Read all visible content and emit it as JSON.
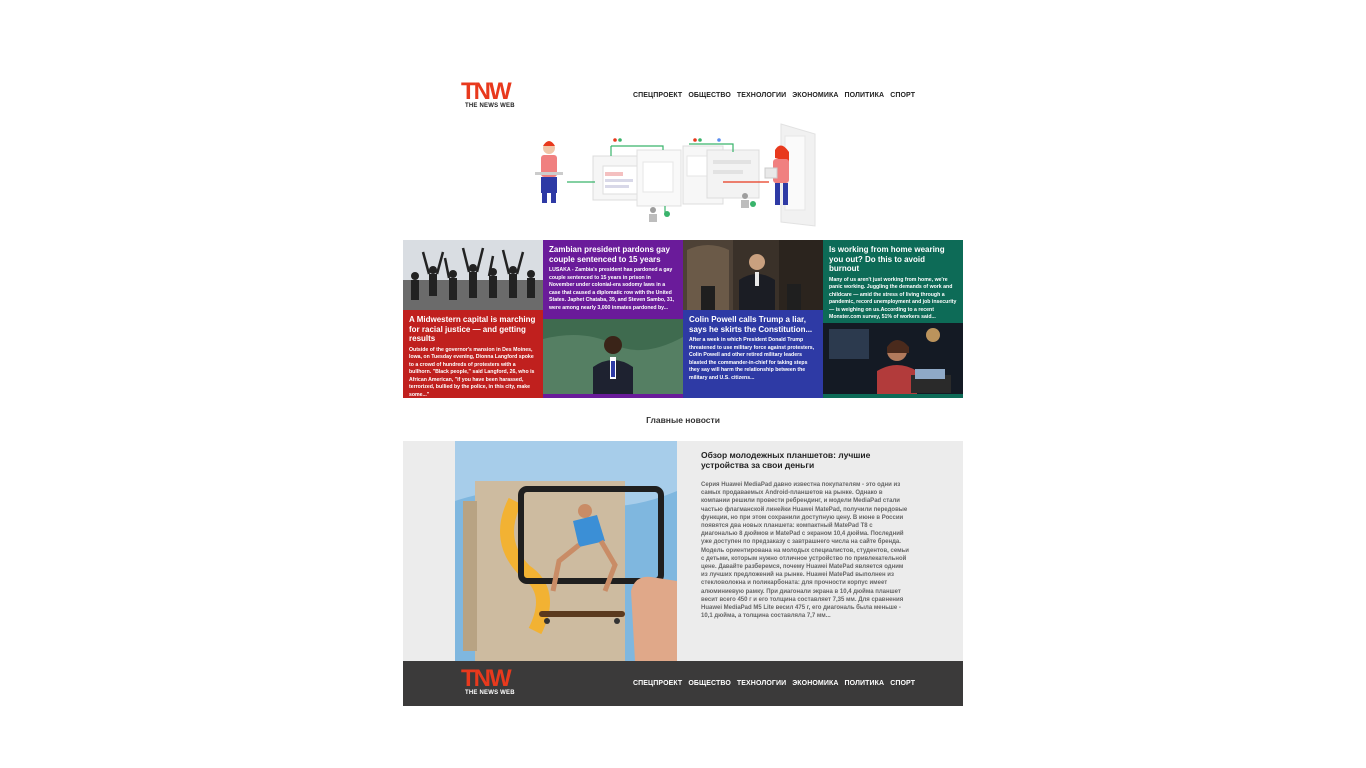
{
  "brand": {
    "logo_text": "TNW",
    "tagline": "THE NEWS WEB",
    "logo_color": "#e8391d"
  },
  "nav": {
    "items": [
      "СПЕЦПРОЕКТ",
      "ОБЩЕСТВО",
      "ТЕХНОЛОГИИ",
      "ЭКОНОМИКА",
      "ПОЛИТИКА",
      "СПОРТ"
    ]
  },
  "grid": {
    "card1": {
      "title": "A Midwestern capital is marching for racial justice — and getting results",
      "text": "Outside of the governor's mansion in Des Moines, Iowa, on Tuesday evening, Dionna Langford spoke to a crowd of hundreds of protesters with a bullhorn. \"Black people,\" said Langford, 26, who is African American, \"if you have been harassed, terrorized, bullied by the police, in this city, make some...\"",
      "color": "#c0201e"
    },
    "card2": {
      "title": "Zambian president pardons gay couple sentenced to 15 years",
      "text": "LUSAKA - Zambia's president has pardoned a gay couple sentenced to 15 years in prison in November under colonial-era sodomy laws in a case that caused a diplomatic row with the United States. Japhet Chataba, 39, and Steven Sambo, 31, were among nearly 3,000 inmates pardoned by...",
      "color": "#6a1b9a"
    },
    "card3": {
      "title": "Colin Powell calls Trump a liar, says he skirts the Constitution...",
      "text": "After a week in which President Donald Trump threatened to use military force against protesters, Colin Powell and other retired military leaders blasted the commander-in-chief for taking steps they say will harm the relationship between the military and U.S. citizens...",
      "color": "#2e3aa5"
    },
    "card4": {
      "title": "Is working from home wearing you out? Do this to avoid burnout",
      "text": "Many of us aren't just working from home, we're panic working. Juggling the demands of work and childcare — amid the stress of living through a pandemic, record unemployment and job insecurity— is weighing on us.According to a recent Monster.com survey, 51% of workers said...",
      "color": "#0d6b57"
    }
  },
  "section_title": "Главные новости",
  "feature": {
    "title": "Обзор молодежных планшетов: лучшие устройства за свои деньги",
    "text": "Серия Huawei MediaPad давно известна покупателям - это одни из самых продаваемых Android-планшетов на рынке. Однако в компании решили провести ребрендинг, и модели MediaPad стали частью флагманской линейки Huawei MatePad, получили передовые функции, но при этом сохранили доступную цену. В июне в России появятся два новых планшета: компактный MatePad T8 с диагональю 8 дюймов и MatePad с экраном 10,4 дюйма. Последний уже доступен по предзаказу с завтрашнего числа на сайте бренда. Модель ориентирована на молодых специалистов, студентов, семьи с детьми, которым нужно отличное устройство по привлекательной цене. Давайте разберемся, почему Huawei MatePad является одним из лучших предложений на рынке. Huawei MatePad выполнен из стекловолокна и поликарбоната: для прочности корпус имеет алюминиевую рамку. При диагонали экрана в 10,4 дюйма планшет весит всего 450 г и его толщина составляет 7,35 мм. Для сравнения Huawei MediaPad M5 Lite весил 475 г, его диагональ была меньше - 10,1 дюйма, а толщина составляла 7,7 мм..."
  },
  "footer": {
    "logo_text": "TNW",
    "tagline": "THE NEWS WEB",
    "nav": [
      "СПЕЦПРОЕКТ",
      "ОБЩЕСТВО",
      "ТЕХНОЛОГИИ",
      "ЭКОНОМИКА",
      "ПОЛИТИКА",
      "СПОРТ"
    ],
    "background": "#3b3a3a"
  }
}
